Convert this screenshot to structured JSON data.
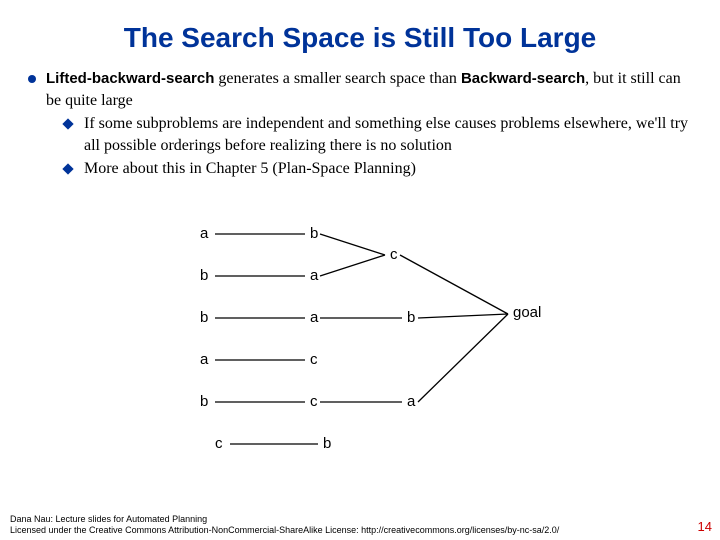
{
  "title": "The Search Space is Still Too Large",
  "bullet": {
    "prefix_bold": "Lifted-backward-search",
    "mid": " generates a smaller search space than ",
    "suffix_bold": "Backward-search",
    "tail": ", but it still can be quite large"
  },
  "subbullets": [
    "If some subproblems are independent and something else causes problems elsewhere, we'll try all possible orderings before realizing there is no solution",
    "More about this in Chapter 5 (Plan-Space Planning)"
  ],
  "diagram": {
    "labels": {
      "a1": "a",
      "b1": "b",
      "b2": "b",
      "a2": "a",
      "c1": "c",
      "b3": "b",
      "a3": "a",
      "b4": "b",
      "goal": "goal",
      "a4": "a",
      "c2": "c",
      "b5": "b",
      "c3": "c",
      "a5": "a",
      "c4": "c",
      "b6": "b"
    }
  },
  "footer": {
    "line1": "Dana Nau: Lecture slides for Automated Planning",
    "line2": "Licensed under the Creative Commons Attribution-NonCommercial-ShareAlike License: http://creativecommons.org/licenses/by-nc-sa/2.0/"
  },
  "page_number": "14"
}
